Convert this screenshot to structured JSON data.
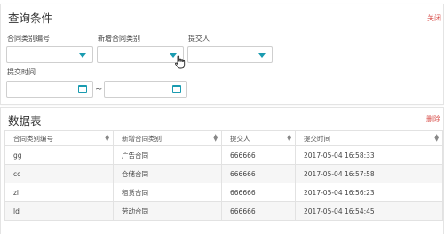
{
  "query_panel": {
    "title": "查询条件",
    "collapse_label": "关闭",
    "fields": {
      "contract_type_code": {
        "label": "合同类别编号",
        "value": ""
      },
      "new_contract_type": {
        "label": "新增合同类别",
        "value": ""
      },
      "submitter": {
        "label": "提交人",
        "value": ""
      },
      "submit_time": {
        "label": "提交时间",
        "separator": "~",
        "start": "",
        "end": ""
      }
    }
  },
  "table_panel": {
    "title": "数据表",
    "delete_label": "删除",
    "columns": [
      "合同类别编号",
      "新增合同类别",
      "提交人",
      "提交时间"
    ],
    "rows": [
      [
        "gg",
        "广告合同",
        "666666",
        "2017-05-04 16:58:33"
      ],
      [
        "cc",
        "仓储合同",
        "666666",
        "2017-05-04 16:57:58"
      ],
      [
        "zl",
        "租赁合同",
        "666666",
        "2017-05-04 16:56:23"
      ],
      [
        "ld",
        "劳动合同",
        "666666",
        "2017-05-04 16:54:45"
      ]
    ]
  },
  "colors": {
    "accent": "#1a9bb0",
    "danger": "#d9534f"
  },
  "icons": {
    "dropdown": "caret-down-icon",
    "date": "calendar-icon",
    "sort": "sort-icon",
    "cursor": "hand-pointer-icon"
  }
}
